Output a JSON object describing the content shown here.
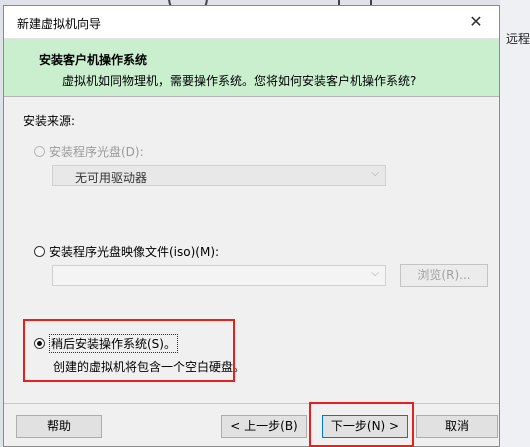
{
  "dialog": {
    "title": "新建虚拟机向导",
    "close_glyph": "✕",
    "header_title": "安装客户机操作系统",
    "header_subtitle": "虚拟机如同物理机，需要操作系统。您将如何安装客户机操作系统?"
  },
  "install_source": {
    "label": "安装来源:",
    "option_disc": "安装程序光盘(D):",
    "disc_combo_value": "无可用驱动器",
    "option_iso": "安装程序光盘映像文件(iso)(M):",
    "iso_combo_value": "",
    "browse_label": "浏览(R)...",
    "option_later": "稍后安装操作系统(S)。",
    "later_description": "创建的虚拟机将包含一个空白硬盘。"
  },
  "buttons": {
    "help": "帮助",
    "back": "< 上一步(B)",
    "next": "下一步(N) >",
    "cancel": "取消"
  },
  "background_app": {
    "partial_text": "远程"
  },
  "colors": {
    "header_bg": "#c9efcf",
    "highlight": "#e8201c"
  }
}
